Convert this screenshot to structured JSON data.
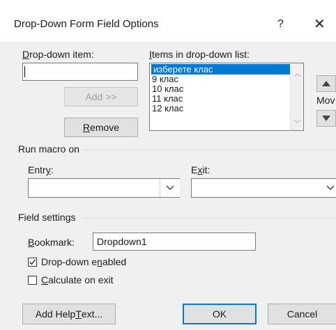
{
  "window": {
    "title": "Drop-Down Form Field Options",
    "help_glyph": "?",
    "close_glyph": "✕"
  },
  "dropdown_item": {
    "label_prefix": "D",
    "label_rest": "rop-down item:",
    "value": ""
  },
  "add_button": {
    "label": "Add >>"
  },
  "remove_button": {
    "label_prefix": "R",
    "label_rest": "emove"
  },
  "items_list": {
    "label_prefix": "I",
    "label_rest": "tems in drop-down list:",
    "items": [
      "изберете клас",
      "9 клас",
      "10 клас",
      "11 клас",
      "12 клас"
    ],
    "selected_index": 0
  },
  "move": {
    "label": "Mov",
    "up_icon": "triangle-up",
    "down_icon": "triangle-down"
  },
  "run_macro": {
    "title": "Run macro on",
    "entry_label_prefix": "Entr",
    "entry_label_underline": "y",
    "entry_label_suffix": ":",
    "exit_label_prefix": "E",
    "exit_label_underline": "x",
    "exit_label_suffix": "it:",
    "entry_value": "",
    "exit_value": ""
  },
  "field_settings": {
    "title": "Field settings",
    "bookmark_label_underline": "B",
    "bookmark_label_rest": "ookmark:",
    "bookmark_value": "Dropdown1",
    "dropdown_enabled_prefix": "Drop-down e",
    "dropdown_enabled_underline": "n",
    "dropdown_enabled_suffix": "abled",
    "dropdown_enabled_checked": true,
    "calculate_underline": "C",
    "calculate_rest": "alculate on exit",
    "calculate_checked": false
  },
  "footer": {
    "help_text_prefix": "Add Help ",
    "help_text_underline": "T",
    "help_text_suffix": "ext...",
    "ok_label": "OK",
    "cancel_label": "Cancel"
  },
  "colors": {
    "selection": "#0078d7",
    "dialog_background": "#f0f0f0",
    "default_button_border": "#0078d7"
  }
}
